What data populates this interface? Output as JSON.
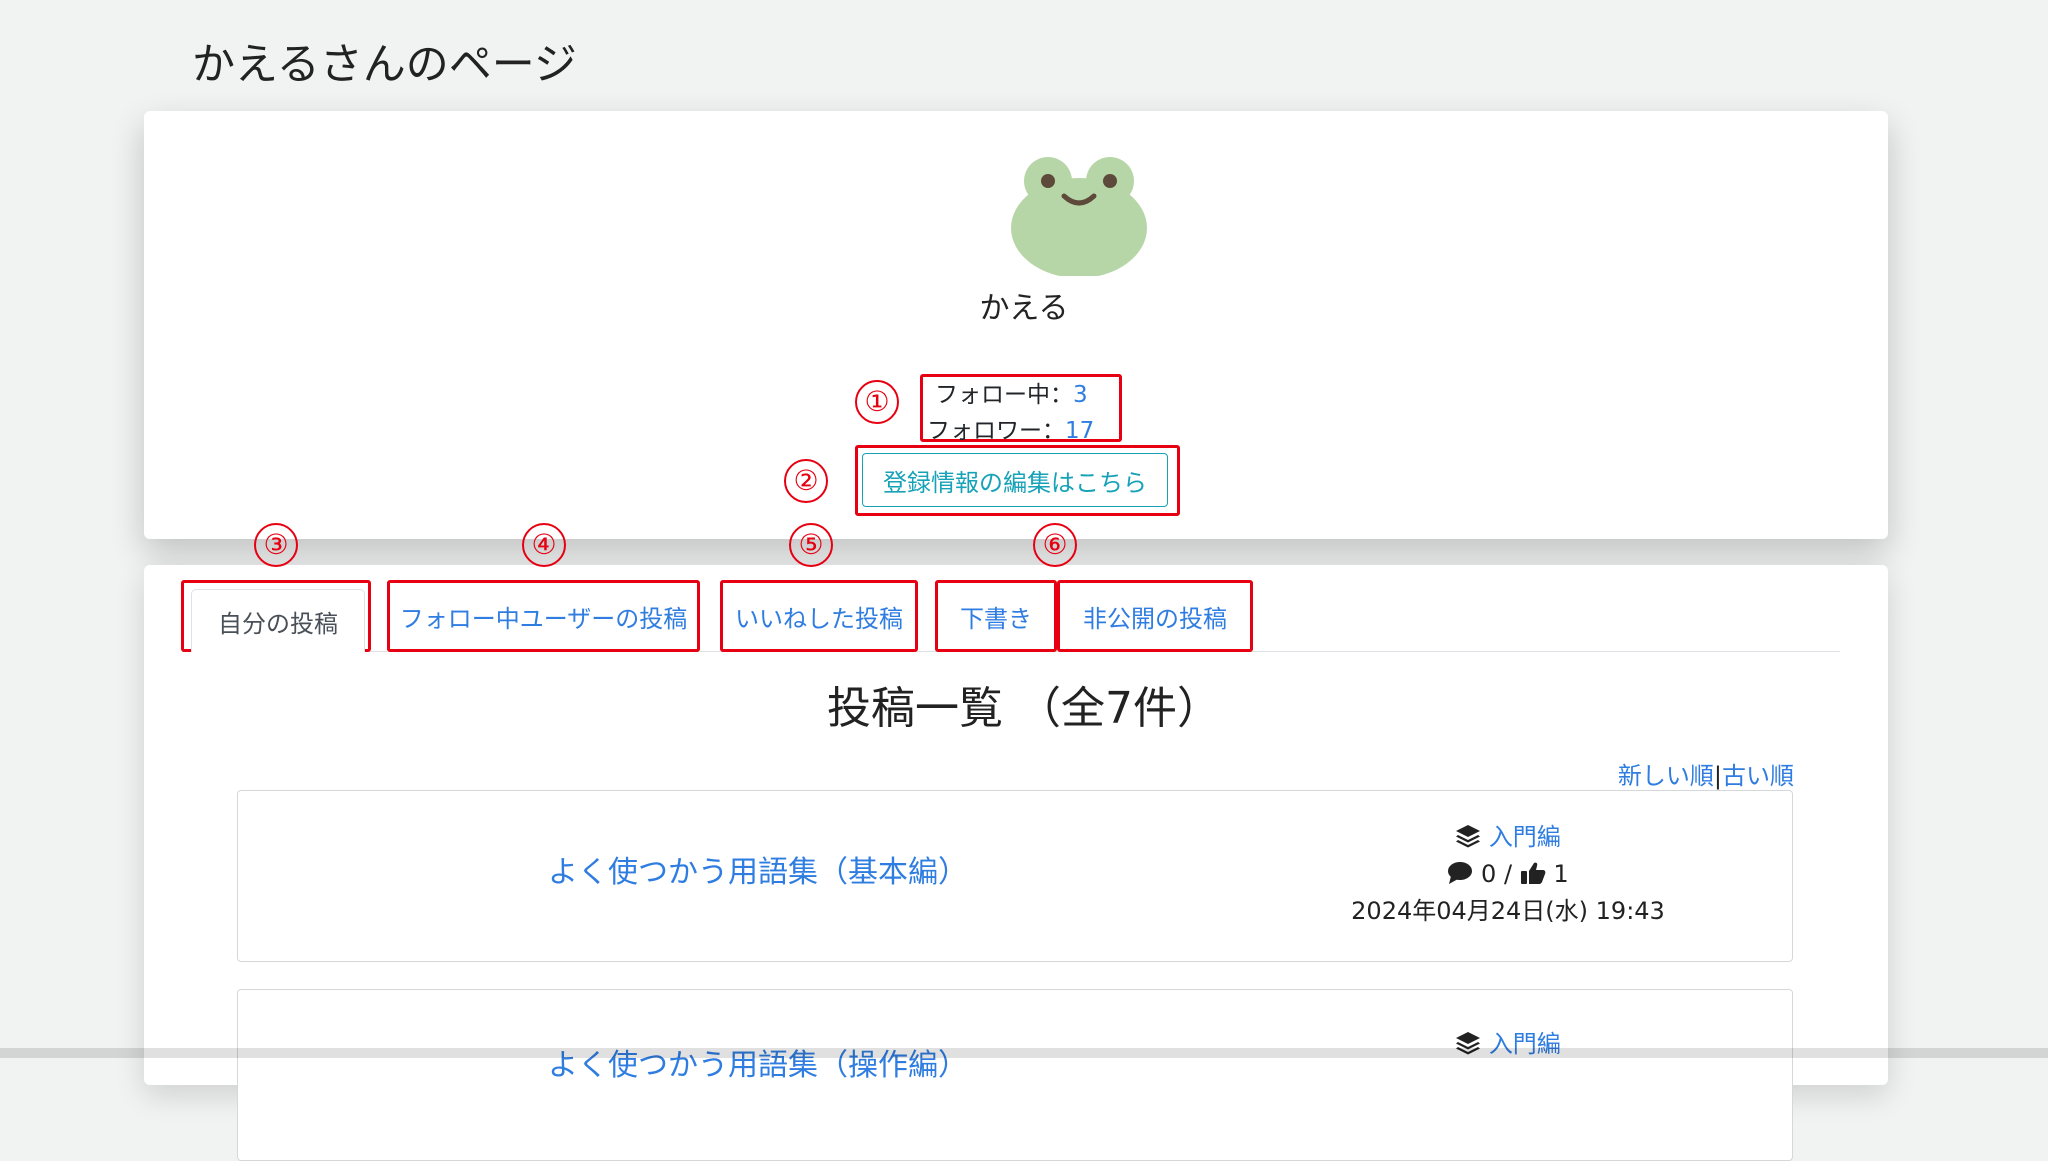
{
  "page": {
    "title": "かえるさんのページ"
  },
  "profile": {
    "avatar_icon": "frog-avatar-icon",
    "username": "かえる",
    "following_label": "フォロー中：",
    "following_count": "3",
    "followers_label": "フォロワー：",
    "followers_count": "17",
    "edit_button_label": "登録情報の編集はこちら"
  },
  "annotations": [
    "①",
    "②",
    "③",
    "④",
    "⑤",
    "⑥"
  ],
  "annotation_color": "#e60012",
  "tabs": [
    {
      "label": "自分の投稿",
      "active": true
    },
    {
      "label": "フォロー中ユーザーの投稿",
      "active": false
    },
    {
      "label": "いいねした投稿",
      "active": false
    },
    {
      "label": "下書き",
      "active": false
    },
    {
      "label": "非公開の投稿",
      "active": false
    }
  ],
  "list": {
    "heading": "投稿一覧 （全7件）",
    "sort_new": "新しい順",
    "sort_separator": "|",
    "sort_old": "古い順"
  },
  "posts": [
    {
      "title": "よく使つかう用語集（基本編）",
      "category": "入門編",
      "comments": "0",
      "meta_separator": "/",
      "likes": "1",
      "date": "2024年04月24日(水) 19:43"
    },
    {
      "title": "よく使つかう用語集（操作編）",
      "category": "入門編"
    }
  ],
  "colors": {
    "link": "#2f7de1",
    "edit_button": "#17a2b8",
    "frog": "#b7d6a8"
  }
}
